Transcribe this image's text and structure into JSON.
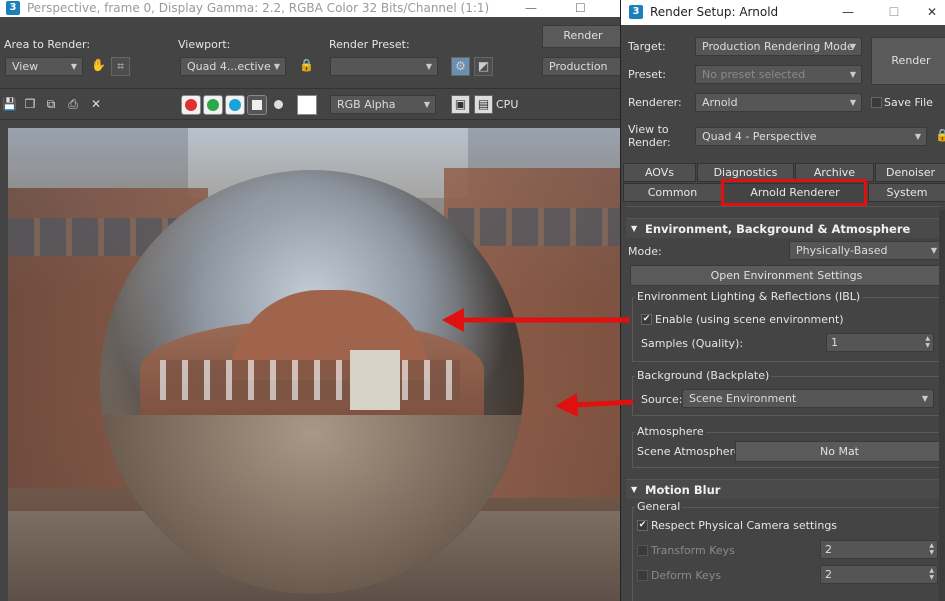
{
  "frame_window": {
    "title": "Perspective, frame 0, Display Gamma: 2.2, RGBA Color 32 Bits/Channel (1:1)",
    "area_to_render_label": "Area to Render:",
    "area_to_render_value": "View",
    "viewport_label": "Viewport:",
    "viewport_value": "Quad 4...ective",
    "render_preset_label": "Render Preset:",
    "render_preset_value": "",
    "render_button": "Render",
    "production_value": "Production",
    "channel_value": "RGB Alpha",
    "cpu_label": "CPU"
  },
  "render_setup": {
    "title": "Render Setup: Arnold",
    "target_label": "Target:",
    "target_value": "Production Rendering Mode",
    "preset_label": "Preset:",
    "preset_value": "No preset selected",
    "renderer_label": "Renderer:",
    "renderer_value": "Arnold",
    "save_file_label": "Save File",
    "view_label_line1": "View to",
    "view_label_line2": "Render:",
    "view_value": "Quad 4 - Perspective",
    "render_button": "Render",
    "tabs_row1": [
      "AOVs",
      "Diagnostics",
      "Archive",
      "Denoiser"
    ],
    "tabs_row2": [
      "Common",
      "Arnold Renderer",
      "System"
    ],
    "env_section": {
      "title": "Environment, Background & Atmosphere",
      "mode_label": "Mode:",
      "mode_value": "Physically-Based",
      "open_env_button": "Open Environment Settings",
      "ibl_group_title": "Environment Lighting & Reflections (IBL)",
      "enable_label": "Enable (using scene environment)",
      "samples_label": "Samples (Quality):",
      "samples_value": "1",
      "background_group_title": "Background (Backplate)",
      "source_label": "Source:",
      "source_value": "Scene Environment",
      "atmosphere_group_title": "Atmosphere",
      "scene_atmosphere_label": "Scene Atmosphere:",
      "scene_atmosphere_value": "No Mat"
    },
    "motion_blur_section": {
      "title": "Motion Blur",
      "general_label": "General",
      "respect_camera_label": "Respect Physical Camera settings",
      "transform_keys_label": "Transform Keys",
      "transform_keys_value": "2",
      "deform_keys_label": "Deform Keys",
      "deform_keys_value": "2"
    }
  },
  "colors": {
    "callout_red": "#e01010",
    "app_icon_blue": "#1b7fb8"
  }
}
